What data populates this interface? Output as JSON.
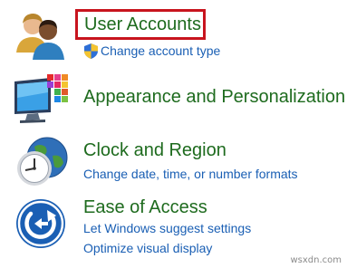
{
  "categories": [
    {
      "title": "User Accounts",
      "icon": "users-icon",
      "links": [
        "Change account type"
      ],
      "link_icon": "uac-shield-icon"
    },
    {
      "title": "Appearance and Personalization",
      "icon": "monitor-palette-icon",
      "links": []
    },
    {
      "title": "Clock and Region",
      "icon": "clock-globe-icon",
      "links": [
        "Change date, time, or number formats"
      ]
    },
    {
      "title": "Ease of Access",
      "icon": "ease-of-access-icon",
      "links": [
        "Let Windows suggest settings",
        "Optimize visual display"
      ]
    }
  ],
  "colors": {
    "title_green": "#1e6b1e",
    "link_blue": "#1a5fb4",
    "highlight_red": "#c8141e"
  },
  "watermark": "wsxdn.com"
}
